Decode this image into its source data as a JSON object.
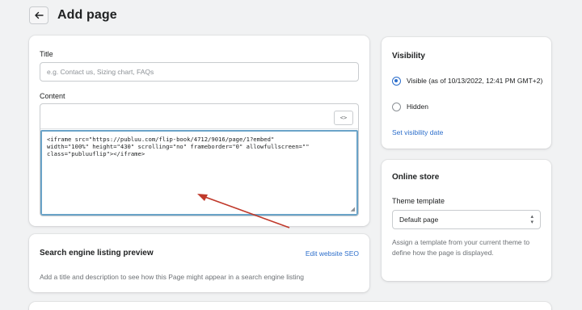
{
  "header": {
    "title": "Add page"
  },
  "main": {
    "title_label": "Title",
    "title_placeholder": "e.g. Contact us, Sizing chart, FAQs",
    "title_value": "",
    "content_label": "Content",
    "html_button": "<>",
    "code": "<iframe src=\"https://publuu.com/flip-book/4712/9016/page/1?embed\"\nwidth=\"100%\" height=\"430\" scrolling=\"no\" frameborder=\"0\" allowfullscreen=\"\"\nclass=\"publuuflip\"></iframe>"
  },
  "seo": {
    "title": "Search engine listing preview",
    "edit_link": "Edit website SEO",
    "description": "Add a title and description to see how this Page might appear in a search engine listing"
  },
  "visibility": {
    "title": "Visibility",
    "visible_label": "Visible (as of 10/13/2022, 12:41 PM GMT+2)",
    "hidden_label": "Hidden",
    "set_date_link": "Set visibility date",
    "selected": "visible"
  },
  "online_store": {
    "title": "Online store",
    "template_label": "Theme template",
    "template_value": "Default page",
    "help_text": "Assign a template from your current theme to define how the page is displayed."
  },
  "colors": {
    "background": "#f1f2f3",
    "link": "#2c6ecb",
    "focus_border": "#6aa3c8",
    "annotation_arrow": "#c0392b"
  },
  "icons": {
    "back": "arrow-left-icon",
    "html": "code-icon",
    "select": "chevron-updown-icon",
    "resize": "resize-handle-icon"
  }
}
